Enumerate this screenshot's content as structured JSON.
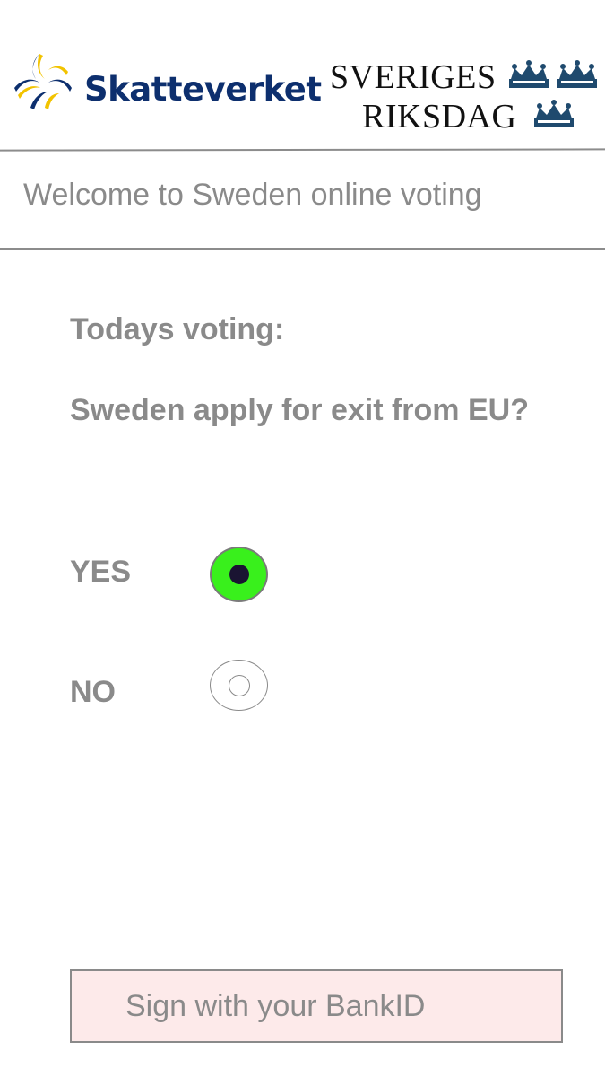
{
  "header": {
    "agency_logo_text": "Skatteverket",
    "parliament_logo_line1": "SVERIGES",
    "parliament_logo_line2": "RIKSDAG"
  },
  "welcome_text": "Welcome to Sweden online voting",
  "vote": {
    "title": "Todays voting:",
    "question": "Sweden apply for exit from EU?",
    "options": [
      {
        "label": "YES",
        "selected": true
      },
      {
        "label": "NO",
        "selected": false
      }
    ]
  },
  "sign_button_label": "Sign with your BankID",
  "colors": {
    "agency_blue": "#0d2f6e",
    "agency_yellow": "#f2c300",
    "crown_blue": "#1f4a6e",
    "selected_radio_fill": "#39f01c",
    "selected_radio_dot": "#1a1432",
    "button_background": "#fdeaea",
    "text_gray": "#8a8a8a"
  },
  "icons": {
    "agency_mark": "skatteverket-swirl-icon",
    "crown": "crown-icon"
  }
}
